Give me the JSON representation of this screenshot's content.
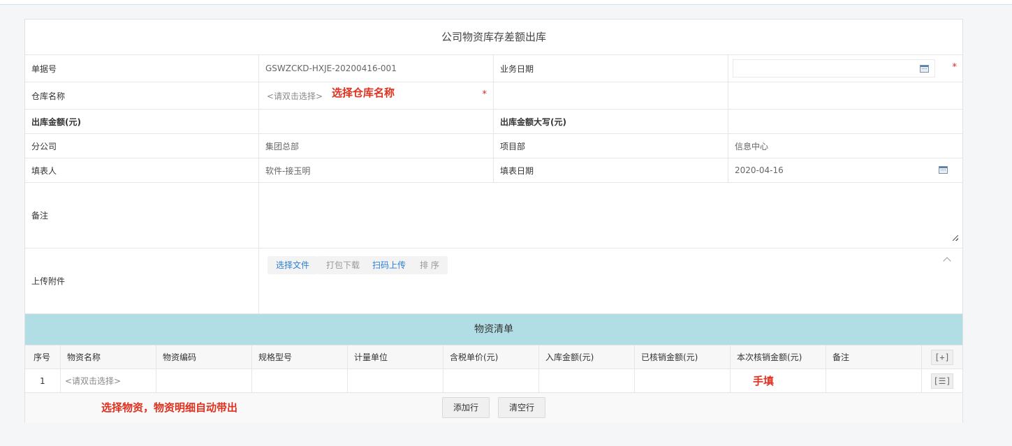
{
  "form": {
    "title": "公司物资库存差额出库",
    "fields": {
      "doc_no_label": "单据号",
      "doc_no_value": "GSWZCKD-HXJE-20200416-001",
      "biz_date_label": "业务日期",
      "biz_date_value": "",
      "warehouse_label": "仓库名称",
      "warehouse_placeholder": "<请双击选择>",
      "warehouse_annotation": "选择仓库名称",
      "out_amount_label": "出库金额(元)",
      "out_amount_value": "",
      "out_amount_upper_label": "出库金额大写(元)",
      "out_amount_upper_value": "",
      "branch_label": "分公司",
      "branch_value": "集团总部",
      "project_label": "项目部",
      "project_value": "信息中心",
      "filler_label": "填表人",
      "filler_value": "软件-接玉明",
      "fill_date_label": "填表日期",
      "fill_date_value": "2020-04-16",
      "remark_label": "备注",
      "remark_value": "",
      "attach_label": "上传附件"
    },
    "required_mark": "*",
    "attach_buttons": {
      "select_file": "选择文件",
      "pack_download": "打包下载",
      "scan_upload": "扫码上传",
      "sort": "排 序"
    }
  },
  "materials": {
    "section_title": "物资清单",
    "columns": [
      "序号",
      "物资名称",
      "物资编码",
      "规格型号",
      "计量单位",
      "含税单价(元)",
      "入库金额(元)",
      "已核销金额(元)",
      "本次核销金额(元)",
      "备注"
    ],
    "add_col_button": "[+]",
    "rows": [
      {
        "index": "1",
        "name_placeholder": "<请双击选择>",
        "annotation": "手填",
        "row_menu_button": "[☰]"
      }
    ],
    "footer_annotation": "选择物资，物资明细自动带出",
    "add_row_button": "添加行",
    "clear_row_button": "清空行"
  },
  "colors": {
    "section_header": "#b1dee5",
    "annotation": "#e0301e",
    "link_blue": "#2a7fd4",
    "required": "#e02020"
  }
}
